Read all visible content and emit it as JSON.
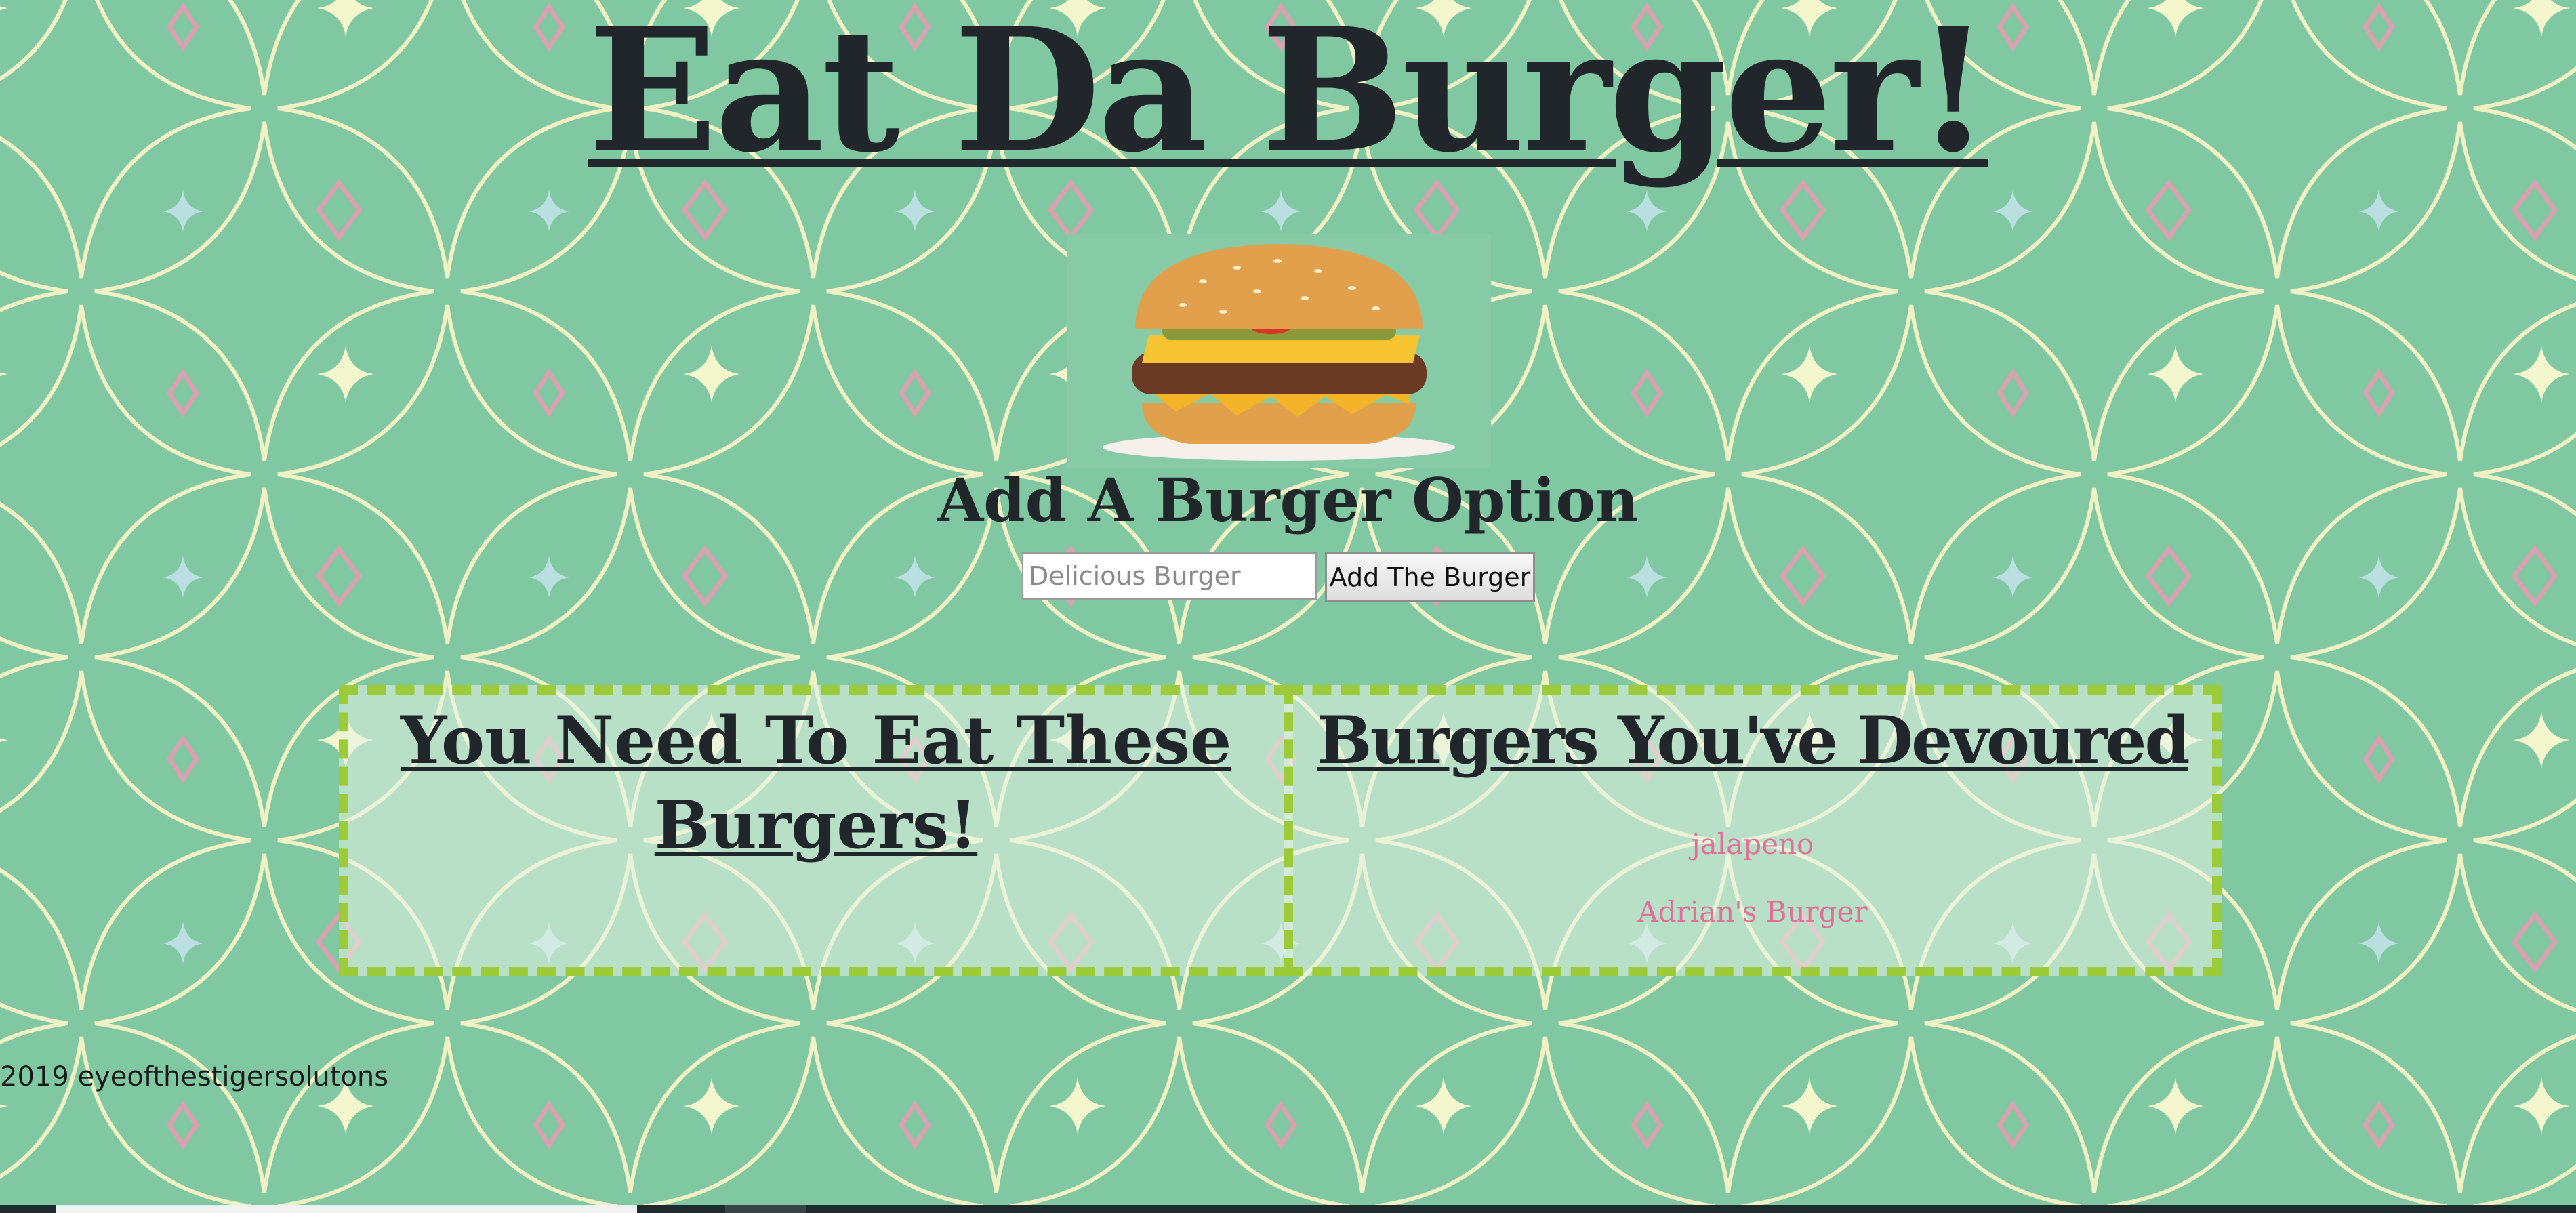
{
  "page": {
    "title": "Eat Da Burger!",
    "background_color": "#7fc8a2",
    "accent_dash_color": "#9ccb3a",
    "burger_name_color": "#e26f96"
  },
  "form": {
    "heading": "Add A Burger Option",
    "input_placeholder": "Delicious Burger",
    "input_value": "",
    "button_label": "Add The Burger"
  },
  "to_eat": {
    "heading": "You Need To Eat These Burgers!",
    "items": []
  },
  "devoured": {
    "heading": "Burgers You've Devoured",
    "items": [
      "jalapeno",
      "Adrian's Burger"
    ]
  },
  "footer": {
    "text": "2019 eyeofthestigersolutons"
  },
  "icons": {
    "hero_image": "cheeseburger-image"
  }
}
